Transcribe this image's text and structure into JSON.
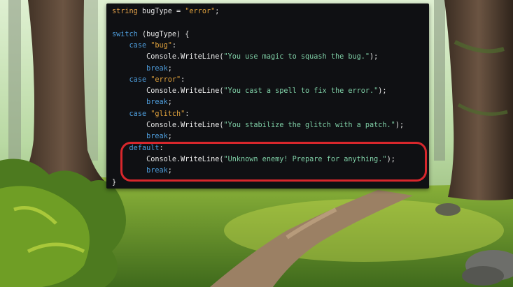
{
  "code": {
    "lines": [
      [
        {
          "t": "string",
          "c": "type"
        },
        {
          "t": " bugType = ",
          "c": "plain"
        },
        {
          "t": "\"error\"",
          "c": "str"
        },
        {
          "t": ";",
          "c": "plain"
        }
      ],
      [],
      [
        {
          "t": "switch",
          "c": "kw"
        },
        {
          "t": " (bugType) {",
          "c": "plain"
        }
      ],
      [
        {
          "t": "    ",
          "c": "plain"
        },
        {
          "t": "case",
          "c": "kw"
        },
        {
          "t": " ",
          "c": "plain"
        },
        {
          "t": "\"bug\"",
          "c": "str"
        },
        {
          "t": ":",
          "c": "plain"
        }
      ],
      [
        {
          "t": "        Console.",
          "c": "plain"
        },
        {
          "t": "WriteLine",
          "c": "fn"
        },
        {
          "t": "(",
          "c": "plain"
        },
        {
          "t": "\"You use magic to squash the bug.\"",
          "c": "strg"
        },
        {
          "t": ");",
          "c": "plain"
        }
      ],
      [
        {
          "t": "        ",
          "c": "plain"
        },
        {
          "t": "break",
          "c": "kw"
        },
        {
          "t": ";",
          "c": "plain"
        }
      ],
      [
        {
          "t": "    ",
          "c": "plain"
        },
        {
          "t": "case",
          "c": "kw"
        },
        {
          "t": " ",
          "c": "plain"
        },
        {
          "t": "\"error\"",
          "c": "str"
        },
        {
          "t": ":",
          "c": "plain"
        }
      ],
      [
        {
          "t": "        Console.",
          "c": "plain"
        },
        {
          "t": "WriteLine",
          "c": "fn"
        },
        {
          "t": "(",
          "c": "plain"
        },
        {
          "t": "\"You cast a spell to fix the error.\"",
          "c": "strg"
        },
        {
          "t": ");",
          "c": "plain"
        }
      ],
      [
        {
          "t": "        ",
          "c": "plain"
        },
        {
          "t": "break",
          "c": "kw"
        },
        {
          "t": ";",
          "c": "plain"
        }
      ],
      [
        {
          "t": "    ",
          "c": "plain"
        },
        {
          "t": "case",
          "c": "kw"
        },
        {
          "t": " ",
          "c": "plain"
        },
        {
          "t": "\"glitch\"",
          "c": "str"
        },
        {
          "t": ":",
          "c": "plain"
        }
      ],
      [
        {
          "t": "        Console.",
          "c": "plain"
        },
        {
          "t": "WriteLine",
          "c": "fn"
        },
        {
          "t": "(",
          "c": "plain"
        },
        {
          "t": "\"You stabilize the glitch with a patch.\"",
          "c": "strg"
        },
        {
          "t": ");",
          "c": "plain"
        }
      ],
      [
        {
          "t": "        ",
          "c": "plain"
        },
        {
          "t": "break",
          "c": "kw"
        },
        {
          "t": ";",
          "c": "plain"
        }
      ],
      [
        {
          "t": "    ",
          "c": "plain"
        },
        {
          "t": "default",
          "c": "kw"
        },
        {
          "t": ":",
          "c": "plain"
        }
      ],
      [
        {
          "t": "        Console.",
          "c": "plain"
        },
        {
          "t": "WriteLine",
          "c": "fn"
        },
        {
          "t": "(",
          "c": "plain"
        },
        {
          "t": "\"Unknown enemy! Prepare for anything.\"",
          "c": "strg"
        },
        {
          "t": ");",
          "c": "plain"
        }
      ],
      [
        {
          "t": "        ",
          "c": "plain"
        },
        {
          "t": "break",
          "c": "kw"
        },
        {
          "t": ";",
          "c": "plain"
        }
      ],
      [
        {
          "t": "}",
          "c": "plain"
        }
      ]
    ]
  },
  "colors": {
    "panel_bg": "#0f1013",
    "keyword": "#4f9fde",
    "string": "#e0a23c",
    "output_string": "#7fcfa6",
    "highlight": "#d8272c"
  }
}
